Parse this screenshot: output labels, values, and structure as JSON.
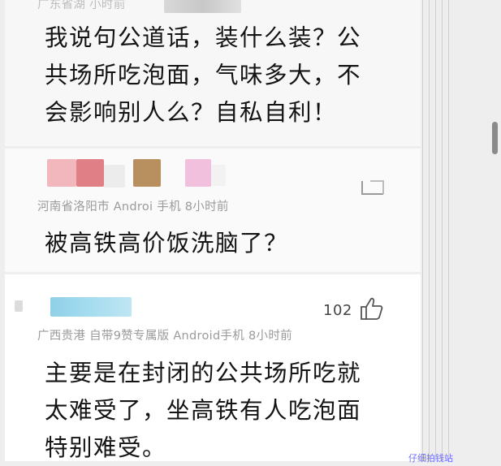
{
  "comments": [
    {
      "location_line": "广东省湖                      小时前",
      "text_lines": [
        "我说句公道话，装什么装？公",
        "共场所吃泡面，气味多大，不",
        "会影响别人么？自私自利！"
      ]
    },
    {
      "location_line": "河南省洛阳市  Androi  手机  8小时前",
      "text_lines": [
        "被高铁高价饭洗脑了？"
      ]
    },
    {
      "location_line": "广西贵港  自带9赞专属版 Android手机  8小时前",
      "like_count": "102",
      "text_lines": [
        "主要是在封闭的公共场所吃就",
        "太难受了，坐高铁有人吃泡面",
        "特别难受。"
      ]
    }
  ],
  "colors": {
    "avatar_pink": "#f0a0a8",
    "avatar_brown": "#b89060",
    "name_cyan": "#8fd0e8"
  },
  "icons": [
    "reply-icon",
    "thumbs-up-icon",
    "scrollbar-thumb"
  ],
  "watermark": "仔细拍钱站"
}
